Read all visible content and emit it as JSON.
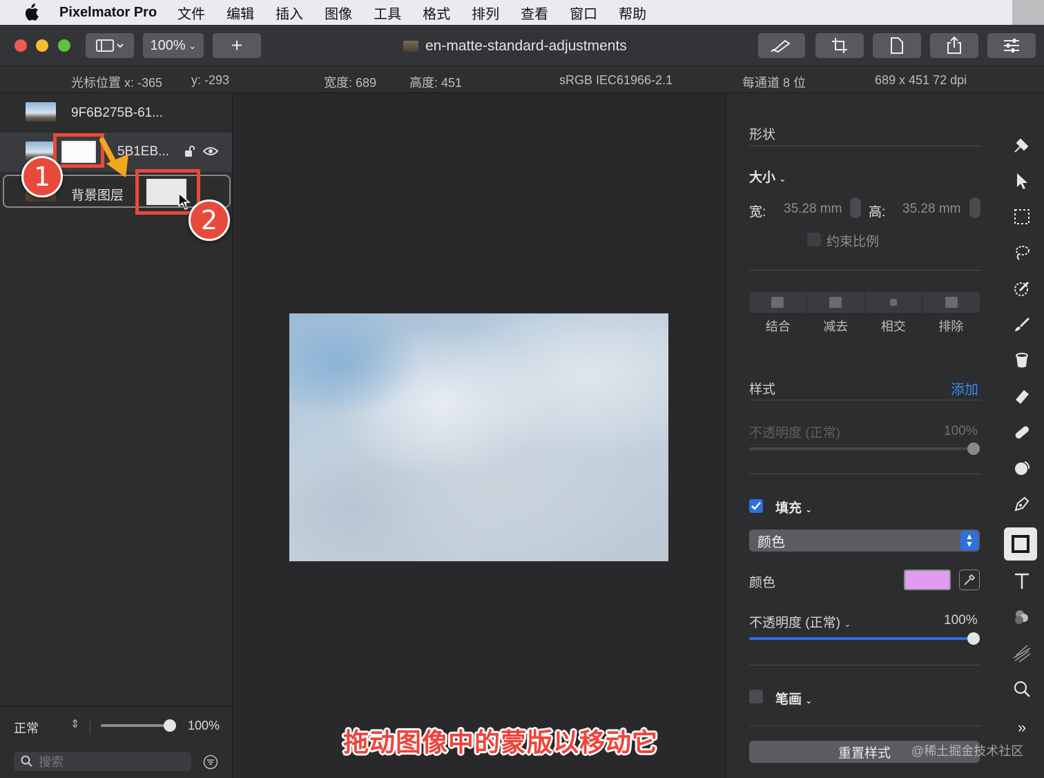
{
  "menubar": {
    "app_name": "Pixelmator Pro",
    "items": [
      "文件",
      "编辑",
      "插入",
      "图像",
      "工具",
      "格式",
      "排列",
      "查看",
      "窗口",
      "帮助"
    ]
  },
  "toolbar": {
    "zoom_label": "100%",
    "add_label": "+",
    "document_title": "en-matte-standard-adjustments"
  },
  "infobar": {
    "cursor_x": "光标位置 x:  -365",
    "cursor_y": "y:  -293",
    "width": "宽度:  689",
    "height": "高度:  451",
    "color_profile": "sRGB IEC61966-2.1",
    "bit_depth": "每通道 8 位",
    "size_dpi": "689 x 451 72 dpi"
  },
  "layers": {
    "items": [
      {
        "name": "9F6B275B-61..."
      },
      {
        "name": "5B1EB..."
      },
      {
        "name": "背景图层"
      }
    ],
    "blend_mode": "正常",
    "opacity": "100%",
    "opacity_value": 1.0,
    "search_placeholder": "搜索"
  },
  "annotations": {
    "badge1": "1",
    "badge2": "2",
    "caption": "拖动图像中的蒙版以移动它"
  },
  "inspector": {
    "shape_title": "形状",
    "size_label": "大小",
    "width_label": "宽:",
    "width_value": "35.28 mm",
    "height_label": "高:",
    "height_value": "35.28 mm",
    "constrain_label": "约束比例",
    "bool_ops": [
      "结合",
      "减去",
      "相交",
      "排除"
    ],
    "style_title": "样式",
    "add_label": "添加",
    "opacity_disabled_label": "不透明度 (正常)",
    "opacity_disabled_value": "100%",
    "fill_label": "填充",
    "fill_checked": true,
    "fill_type": "颜色",
    "color_label": "颜色",
    "fill_color": "#e09cf0",
    "opacity_label": "不透明度 (正常)",
    "opacity_value": "100%",
    "stroke_label": "笔画",
    "stroke_checked": false,
    "reset_label": "重置样式"
  },
  "tools": [
    "style-tool-icon",
    "arrange-tool-icon",
    "selection-tool-icon",
    "lasso-tool-icon",
    "quick-selection-icon",
    "paint-brush-icon",
    "fill-bucket-icon",
    "eraser-icon",
    "repair-icon",
    "clone-icon",
    "pen-icon",
    "shape-tool-icon",
    "type-tool-icon",
    "color-adjust-icon",
    "distort-icon",
    "zoom-icon",
    "more-tools-icon"
  ],
  "watermark": "@稀土掘金技术社区",
  "colors": {
    "accent_blue": "#2f6fe0",
    "annotation_red": "#e74a3b",
    "annotation_arrow": "#f0a81c"
  }
}
